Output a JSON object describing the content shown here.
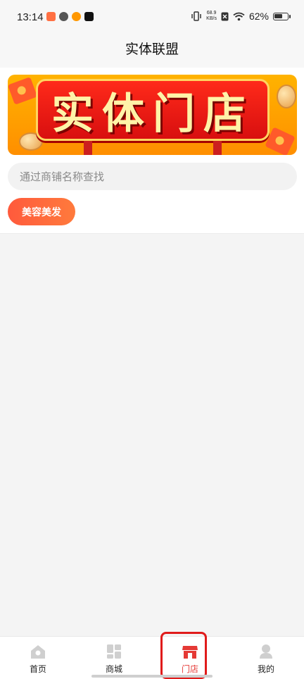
{
  "status_bar": {
    "time": "13:14",
    "net_speed_value": "68.9",
    "net_speed_unit": "KB/s",
    "battery_percent": "62%",
    "battery_level": 0.62
  },
  "header": {
    "title": "实体联盟"
  },
  "banner": {
    "text": "实体门店"
  },
  "search": {
    "placeholder": "通过商铺名称查找",
    "value": ""
  },
  "categories": [
    {
      "label": "美容美发"
    }
  ],
  "bottom_nav": {
    "items": [
      {
        "label": "首页",
        "icon": "home-icon"
      },
      {
        "label": "商城",
        "icon": "grid-icon"
      },
      {
        "label": "门店",
        "icon": "store-icon",
        "active": true
      },
      {
        "label": "我的",
        "icon": "profile-icon"
      }
    ]
  },
  "colors": {
    "accent": "#e53935",
    "chip": "#ff6a3c",
    "banner_bg": "#ffa000"
  }
}
